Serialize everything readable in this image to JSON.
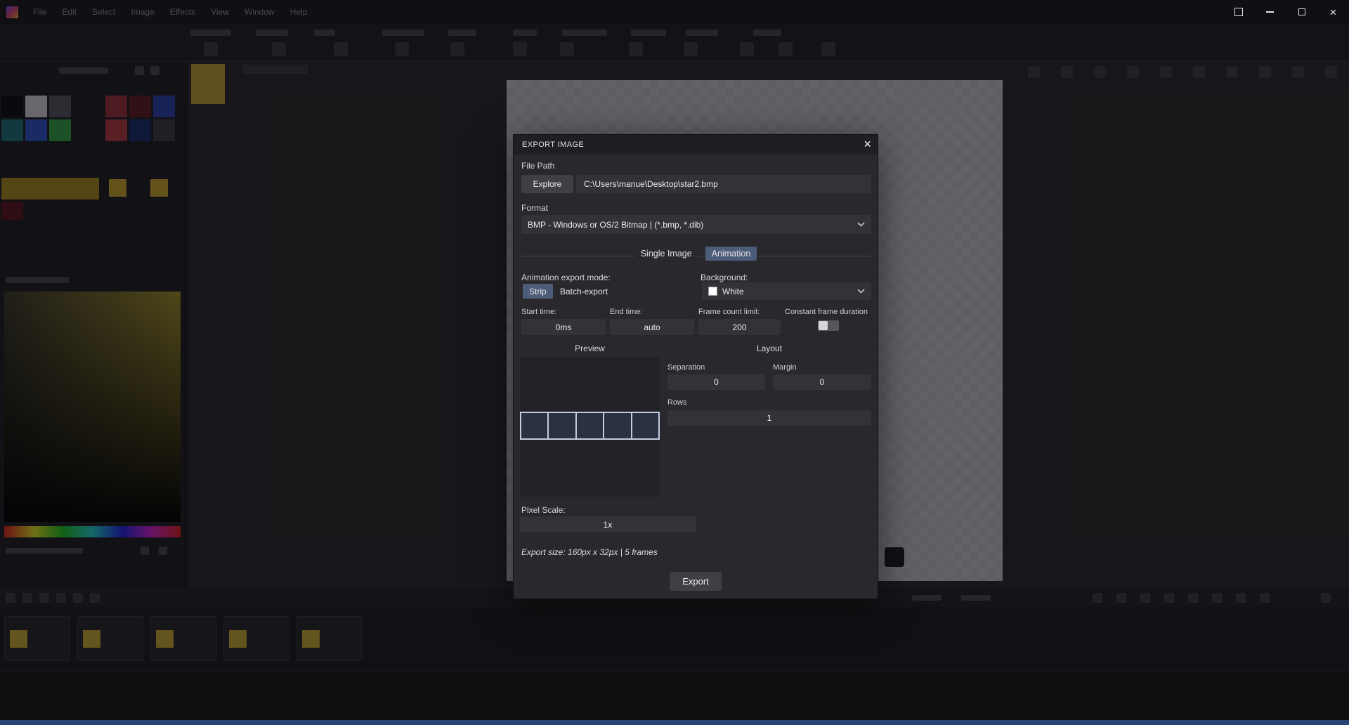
{
  "titlebar": {
    "menus": [
      "File",
      "Edit",
      "Select",
      "Image",
      "Effects",
      "View",
      "Window",
      "Help"
    ]
  },
  "left_panel": {
    "swatches": [
      "#0d0d11",
      "#d2d2d6",
      "#55555c",
      "#962f37",
      "#5e1c23",
      "#2c3fa8",
      "#1f6f79",
      "#2a52c4",
      "#35a245",
      "#b23a41",
      "#1a2a6e",
      "#3c3c44",
      "#a8891e",
      "#c6a62c",
      "#c6a62c",
      "#5a1420"
    ]
  },
  "timeline": {
    "frame_count": 5
  },
  "colors": {
    "dialog_bg": "#29292d",
    "accent_selected": "#4d5c79",
    "field_bg": "#323237",
    "frame_thumbnail_yellow": "#c8a832",
    "bottom_bar_blue": "#4a86ec",
    "background_swatch": "#ffffff"
  },
  "dialog": {
    "title": "EXPORT IMAGE",
    "close_icon": "×",
    "file_path": {
      "label": "File Path",
      "explore_button": "Explore",
      "value": "C:\\Users\\manue\\Desktop\\star2.bmp"
    },
    "format": {
      "label": "Format",
      "value": "BMP - Windows or OS/2 Bitmap | (*.bmp, *.dib)"
    },
    "tabs": [
      {
        "label": "Single Image",
        "selected": false
      },
      {
        "label": "Animation",
        "selected": true
      }
    ],
    "animation_export_mode": {
      "label": "Animation export mode:",
      "options": [
        "Strip",
        "Batch-export"
      ],
      "selected": "Strip"
    },
    "background": {
      "label": "Background:",
      "value": "White"
    },
    "start_time": {
      "label": "Start time:",
      "value": "0ms"
    },
    "end_time": {
      "label": "End time:",
      "value": "auto"
    },
    "frame_count_limit": {
      "label": "Frame count limit:",
      "value": "200"
    },
    "constant_frame_duration": {
      "label": "Constant frame duration",
      "checked": false
    },
    "preview": {
      "label": "Preview",
      "frame_count": 5
    },
    "layout": {
      "label": "Layout",
      "separation": {
        "label": "Separation",
        "value": "0"
      },
      "margin": {
        "label": "Margin",
        "value": "0"
      },
      "rows": {
        "label": "Rows",
        "value": "1"
      }
    },
    "pixel_scale": {
      "label": "Pixel Scale:",
      "value": "1x"
    },
    "export_size_text": "Export size: 160px x 32px | 5 frames",
    "export_button": "Export"
  }
}
